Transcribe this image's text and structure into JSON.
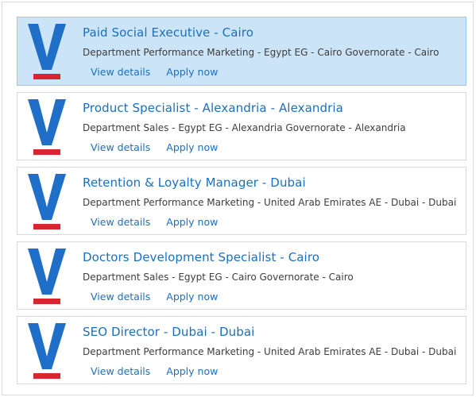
{
  "colors": {
    "link": "#1a70c0",
    "selected_background": "#cce4f7",
    "logo_blue": "#1f6fc8",
    "logo_red": "#d7262e"
  },
  "logo_icon": "v-letter-logo-icon",
  "jobs": [
    {
      "title": "Paid Social Executive - Cairo",
      "meta": "Department Performance Marketing - Egypt EG - Cairo Governorate - Cairo",
      "view_label": "View details",
      "apply_label": "Apply now",
      "selected": true
    },
    {
      "title": "Product Specialist - Alexandria - Alexandria",
      "meta": "Department Sales - Egypt EG - Alexandria Governorate - Alexandria",
      "view_label": "View details",
      "apply_label": "Apply now",
      "selected": false
    },
    {
      "title": "Retention & Loyalty Manager - Dubai",
      "meta": "Department Performance Marketing - United Arab Emirates AE - Dubai - Dubai",
      "view_label": "View details",
      "apply_label": "Apply now",
      "selected": false
    },
    {
      "title": "Doctors Development Specialist - Cairo",
      "meta": "Department Sales - Egypt EG - Cairo Governorate - Cairo",
      "view_label": "View details",
      "apply_label": "Apply now",
      "selected": false
    },
    {
      "title": "SEO Director - Dubai - Dubai",
      "meta": "Department Performance Marketing - United Arab Emirates AE - Dubai - Dubai",
      "view_label": "View details",
      "apply_label": "Apply now",
      "selected": false
    }
  ]
}
